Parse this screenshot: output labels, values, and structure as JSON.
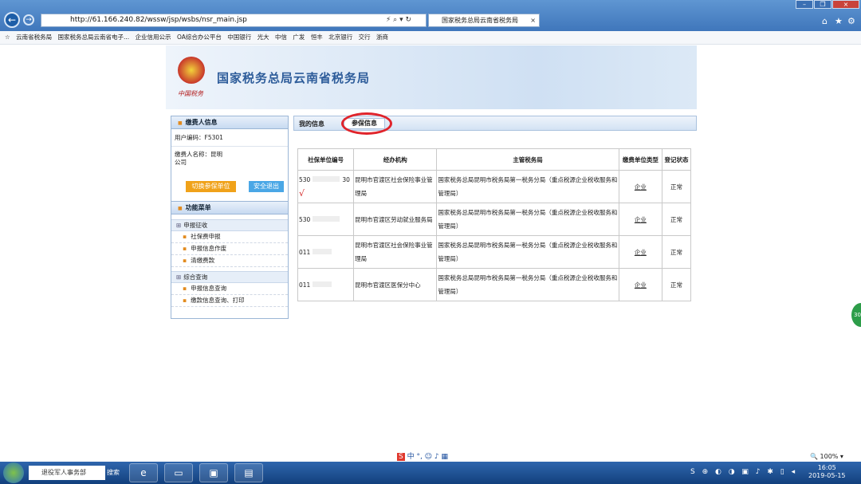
{
  "browser": {
    "url": "http://61.166.240.82/wssw/jsp/wsbs/nsr_main.jsp",
    "tab_title": "国家税务总局云南省税务局",
    "favorites": [
      "云南省税务局",
      "国家税务总局云南省电子...",
      "企业信用公示",
      "OA综合办公平台",
      "中国银行",
      "光大",
      "中信",
      "广发",
      "恒丰",
      "北京银行",
      "交行",
      "浙商"
    ]
  },
  "header": {
    "title": "国家税务总局云南省税务局",
    "emblem_text": "中国税务"
  },
  "sidebar": {
    "taxpayer_title": "缴费人信息",
    "user_code_label": "用户编码：F5301",
    "name_label": "缴费人名称：昆明",
    "name_suffix": "公司",
    "switch_btn": "切换参保单位",
    "logout_btn": "安全退出",
    "menu_title": "功能菜单",
    "groups": [
      {
        "label": "申报征收",
        "items": [
          "社保费申报",
          "申报信息作废",
          "清缴费款"
        ]
      },
      {
        "label": "综合查询",
        "items": [
          "申报信息查询",
          "缴款信息查询、打印"
        ]
      }
    ]
  },
  "tabs": {
    "my_info": "我的信息",
    "insured_info": "参保信息"
  },
  "table": {
    "headers": [
      "社保单位编号",
      "经办机构",
      "主管税务局",
      "缴费单位类型",
      "登记状态"
    ],
    "rows": [
      {
        "code": "530",
        "suffix": "30",
        "agency": "昆明市官渡区社会保险事业管理局",
        "bureau": "国家税务总局昆明市税务局第一税务分局（重点税源企业税收服务和管理局）",
        "type": "企业",
        "status": "正常",
        "checked": "√"
      },
      {
        "code": "530",
        "suffix": "",
        "agency": "昆明市官渡区劳动就业服务局",
        "bureau": "国家税务总局昆明市税务局第一税务分局（重点税源企业税收服务和管理局）",
        "type": "企业",
        "status": "正常",
        "checked": ""
      },
      {
        "code": "011",
        "suffix": "",
        "agency": "昆明市官渡区社会保险事业管理局",
        "bureau": "国家税务总局昆明市税务局第一税务分局（重点税源企业税收服务和管理局）",
        "type": "企业",
        "status": "正常",
        "checked": ""
      },
      {
        "code": "011",
        "suffix": "",
        "agency": "昆明市官渡区医保分中心",
        "bureau": "国家税务总局昆明市税务局第一税务分局（重点税源企业税收服务和管理局）",
        "type": "企业",
        "status": "正常",
        "checked": ""
      }
    ]
  },
  "statusbar": {
    "ime": "中 °, ☺ ♪ ▦",
    "zoom": "100%"
  },
  "taskbar": {
    "search_placeholder": "退役军人事务部",
    "search_btn": "搜索",
    "time": "16:05",
    "date": "2019-05-15"
  },
  "floating": "30"
}
